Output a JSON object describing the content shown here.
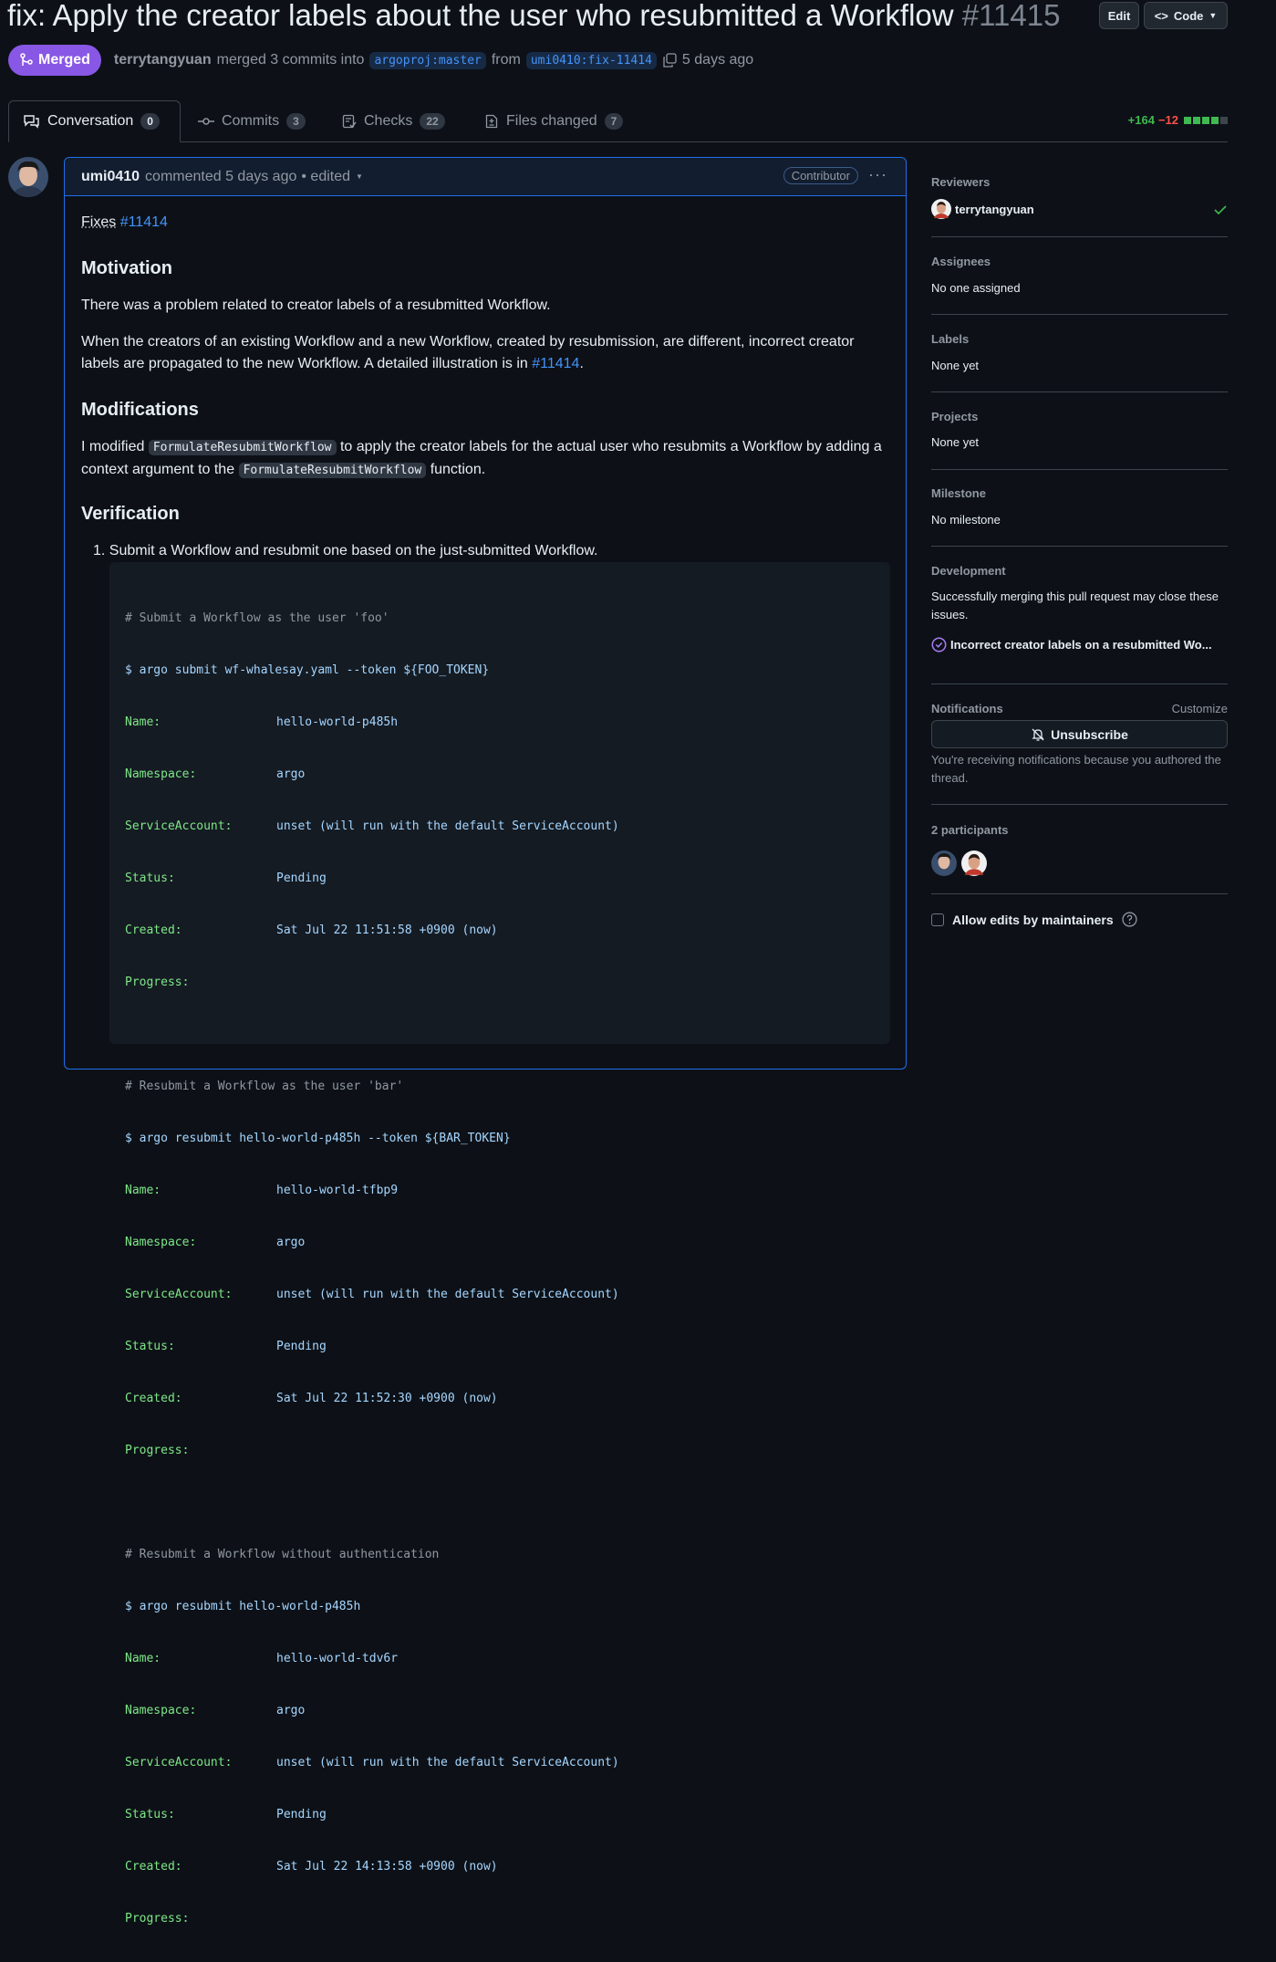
{
  "pr": {
    "title": "fix: Apply the creator labels about the user who resubmitted a Workflow",
    "number": "#11415",
    "edit_label": "Edit",
    "code_label": "Code",
    "status": "Merged",
    "merger": "terrytangyuan",
    "merge_text": "merged 3 commits into",
    "base_branch": "argoproj:master",
    "from_text": "from",
    "head_branch": "umi0410:fix-11414",
    "time": "5 days ago"
  },
  "tabs": [
    {
      "label": "Conversation",
      "count": "0"
    },
    {
      "label": "Commits",
      "count": "3"
    },
    {
      "label": "Checks",
      "count": "22"
    },
    {
      "label": "Files changed",
      "count": "7"
    }
  ],
  "diffstat": {
    "additions": "+164",
    "deletions": "−12"
  },
  "comment": {
    "author": "umi0410",
    "action": "commented 5 days ago",
    "edited": "• edited",
    "role": "Contributor",
    "fixes_prefix": "Fixes",
    "fixes_link": "#11414",
    "h_motivation": "Motivation",
    "motivation_p1": "There was a problem related to creator labels of a resubmitted Workflow.",
    "motivation_p2a": "When the creators of an existing Workflow and a new Workflow, created by resubmission, are different, incorrect creator labels are propagated to the new Workflow. A detailed illustration is in",
    "motivation_p2_link": "#11414",
    "motivation_p2b": ".",
    "h_modifications": "Modifications",
    "mod_a": "I modified",
    "mod_code1": "FormulateResubmitWorkflow",
    "mod_b": "to apply the creator labels for the actual user who resubmits a Workflow by adding a context argument to the",
    "mod_code2": "FormulateResubmitWorkflow",
    "mod_c": "function.",
    "h_verification": "Verification",
    "step1": "1. Submit a Workflow and resubmit one based on the just-submitted Workflow."
  },
  "code_block": {
    "b1_comment": "# Submit a Workflow as the user 'foo'",
    "b1_cmd": "$ argo submit wf-whalesay.yaml --token ${FOO_TOKEN}",
    "b1_name": "hello-world-p485h",
    "b1_ns": "argo",
    "b1_sa": "unset (will run with the default ServiceAccount)",
    "b1_status": "Pending",
    "b1_created": "Sat Jul 22 11:51:58 +0900 (now)",
    "b2_comment": "# Resubmit a Workflow as the user 'bar'",
    "b2_cmd": "$ argo resubmit hello-world-p485h --token ${BAR_TOKEN}",
    "b2_name": "hello-world-tfbp9",
    "b2_ns": "argo",
    "b2_sa": "unset (will run with the default ServiceAccount)",
    "b2_status": "Pending",
    "b2_created": "Sat Jul 22 11:52:30 +0900 (now)",
    "b3_comment": "# Resubmit a Workflow without authentication",
    "b3_cmd": "$ argo resubmit hello-world-p485h",
    "b3_name": "hello-world-tdv6r",
    "b3_ns": "argo",
    "b3_sa": "unset (will run with the default ServiceAccount)",
    "b3_status": "Pending",
    "b3_created": "Sat Jul 22 14:13:58 +0900 (now)",
    "k_name": "Name:",
    "k_ns": "Namespace:",
    "k_sa": "ServiceAccount:",
    "k_status": "Status:",
    "k_created": "Created:",
    "k_progress": "Progress:"
  },
  "sidebar": {
    "reviewers_head": "Reviewers",
    "reviewer": "terrytangyuan",
    "assignees_head": "Assignees",
    "assignees_val": "No one assigned",
    "labels_head": "Labels",
    "labels_val": "None yet",
    "projects_head": "Projects",
    "projects_val": "None yet",
    "milestone_head": "Milestone",
    "milestone_val": "No milestone",
    "dev_head": "Development",
    "dev_text": "Successfully merging this pull request may close these issues.",
    "dev_issue": "Incorrect creator labels on a resubmitted Wo...",
    "notif_head": "Notifications",
    "customize": "Customize",
    "unsubscribe": "Unsubscribe",
    "notif_reason": "You're receiving notifications because you authored the thread.",
    "participants": "2 participants",
    "allow_edits": "Allow edits by maintainers"
  },
  "colors": {
    "merged": "#8957e5",
    "link": "#4493f8",
    "add": "#3fb950",
    "del": "#f85149",
    "accent_border": "#1f6feb"
  }
}
